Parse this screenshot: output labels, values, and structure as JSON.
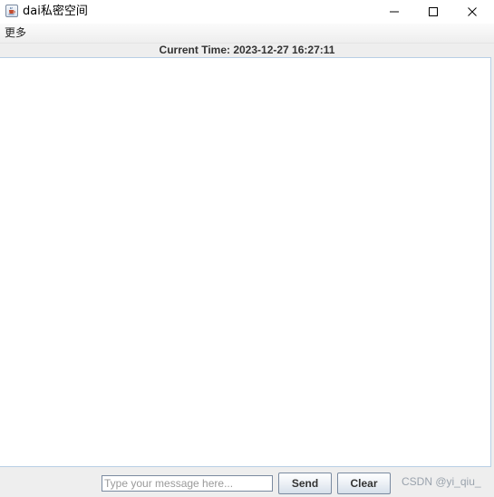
{
  "window": {
    "title": "dai私密空间"
  },
  "menubar": {
    "items": [
      {
        "label": "更多"
      }
    ]
  },
  "status": {
    "current_time": "Current Time: 2023-12-27 16:27:11"
  },
  "message_area": {
    "content": ""
  },
  "composer": {
    "input_value": "",
    "input_placeholder": "Type your message here...",
    "send_label": "Send",
    "clear_label": "Clear"
  },
  "watermark": {
    "text": "CSDN @yi_qiu_"
  },
  "icons": {
    "app": "java-cup-icon",
    "minimize": "minimize-icon",
    "maximize": "maximize-icon",
    "close": "close-icon"
  },
  "colors": {
    "button_border": "#7a8aa0",
    "panel_background": "#eeeeee",
    "text_area_border": "#b8cfe5"
  }
}
